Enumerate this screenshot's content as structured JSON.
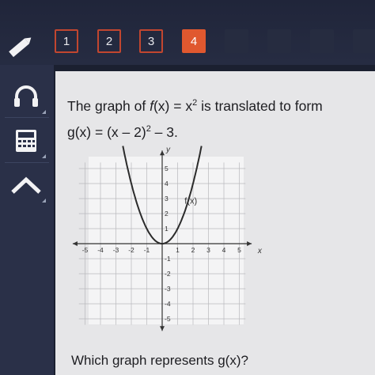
{
  "tabs": [
    {
      "label": "1",
      "state": "normal"
    },
    {
      "label": "2",
      "state": "normal"
    },
    {
      "label": "3",
      "state": "normal"
    },
    {
      "label": "4",
      "state": "active"
    }
  ],
  "sidebar": {
    "tools": [
      "pencil-icon",
      "headphones-icon",
      "calculator-icon",
      "reference-icon"
    ]
  },
  "question": {
    "line1_prefix": "The graph of ",
    "f_name": "f",
    "line1_mid": "(x) = x",
    "exp": "2",
    "line1_suffix": " is translated to form",
    "line2_prefix": "g(x) = (x – 2)",
    "line2_suffix": " – 3.",
    "prompt": "Which graph represents g(x)?"
  },
  "graph": {
    "y_axis_label": "y",
    "x_axis_label": "x",
    "curve_label": "f(x)",
    "function": "x^2",
    "x_ticks": [
      "-5",
      "-4",
      "-3",
      "-2",
      "-1",
      "1",
      "2",
      "3",
      "4",
      "5"
    ],
    "y_ticks": [
      "5",
      "4",
      "3",
      "2",
      "1",
      "-1",
      "-2",
      "-3",
      "-4",
      "-5"
    ],
    "x_range": [
      -5,
      5
    ],
    "y_range": [
      -5,
      5
    ],
    "grid": true
  },
  "colors": {
    "active_tab": "#e0582f",
    "tab_border": "#c2462f",
    "panel": "#e6e6e8",
    "curve": "#2b2b2b"
  }
}
